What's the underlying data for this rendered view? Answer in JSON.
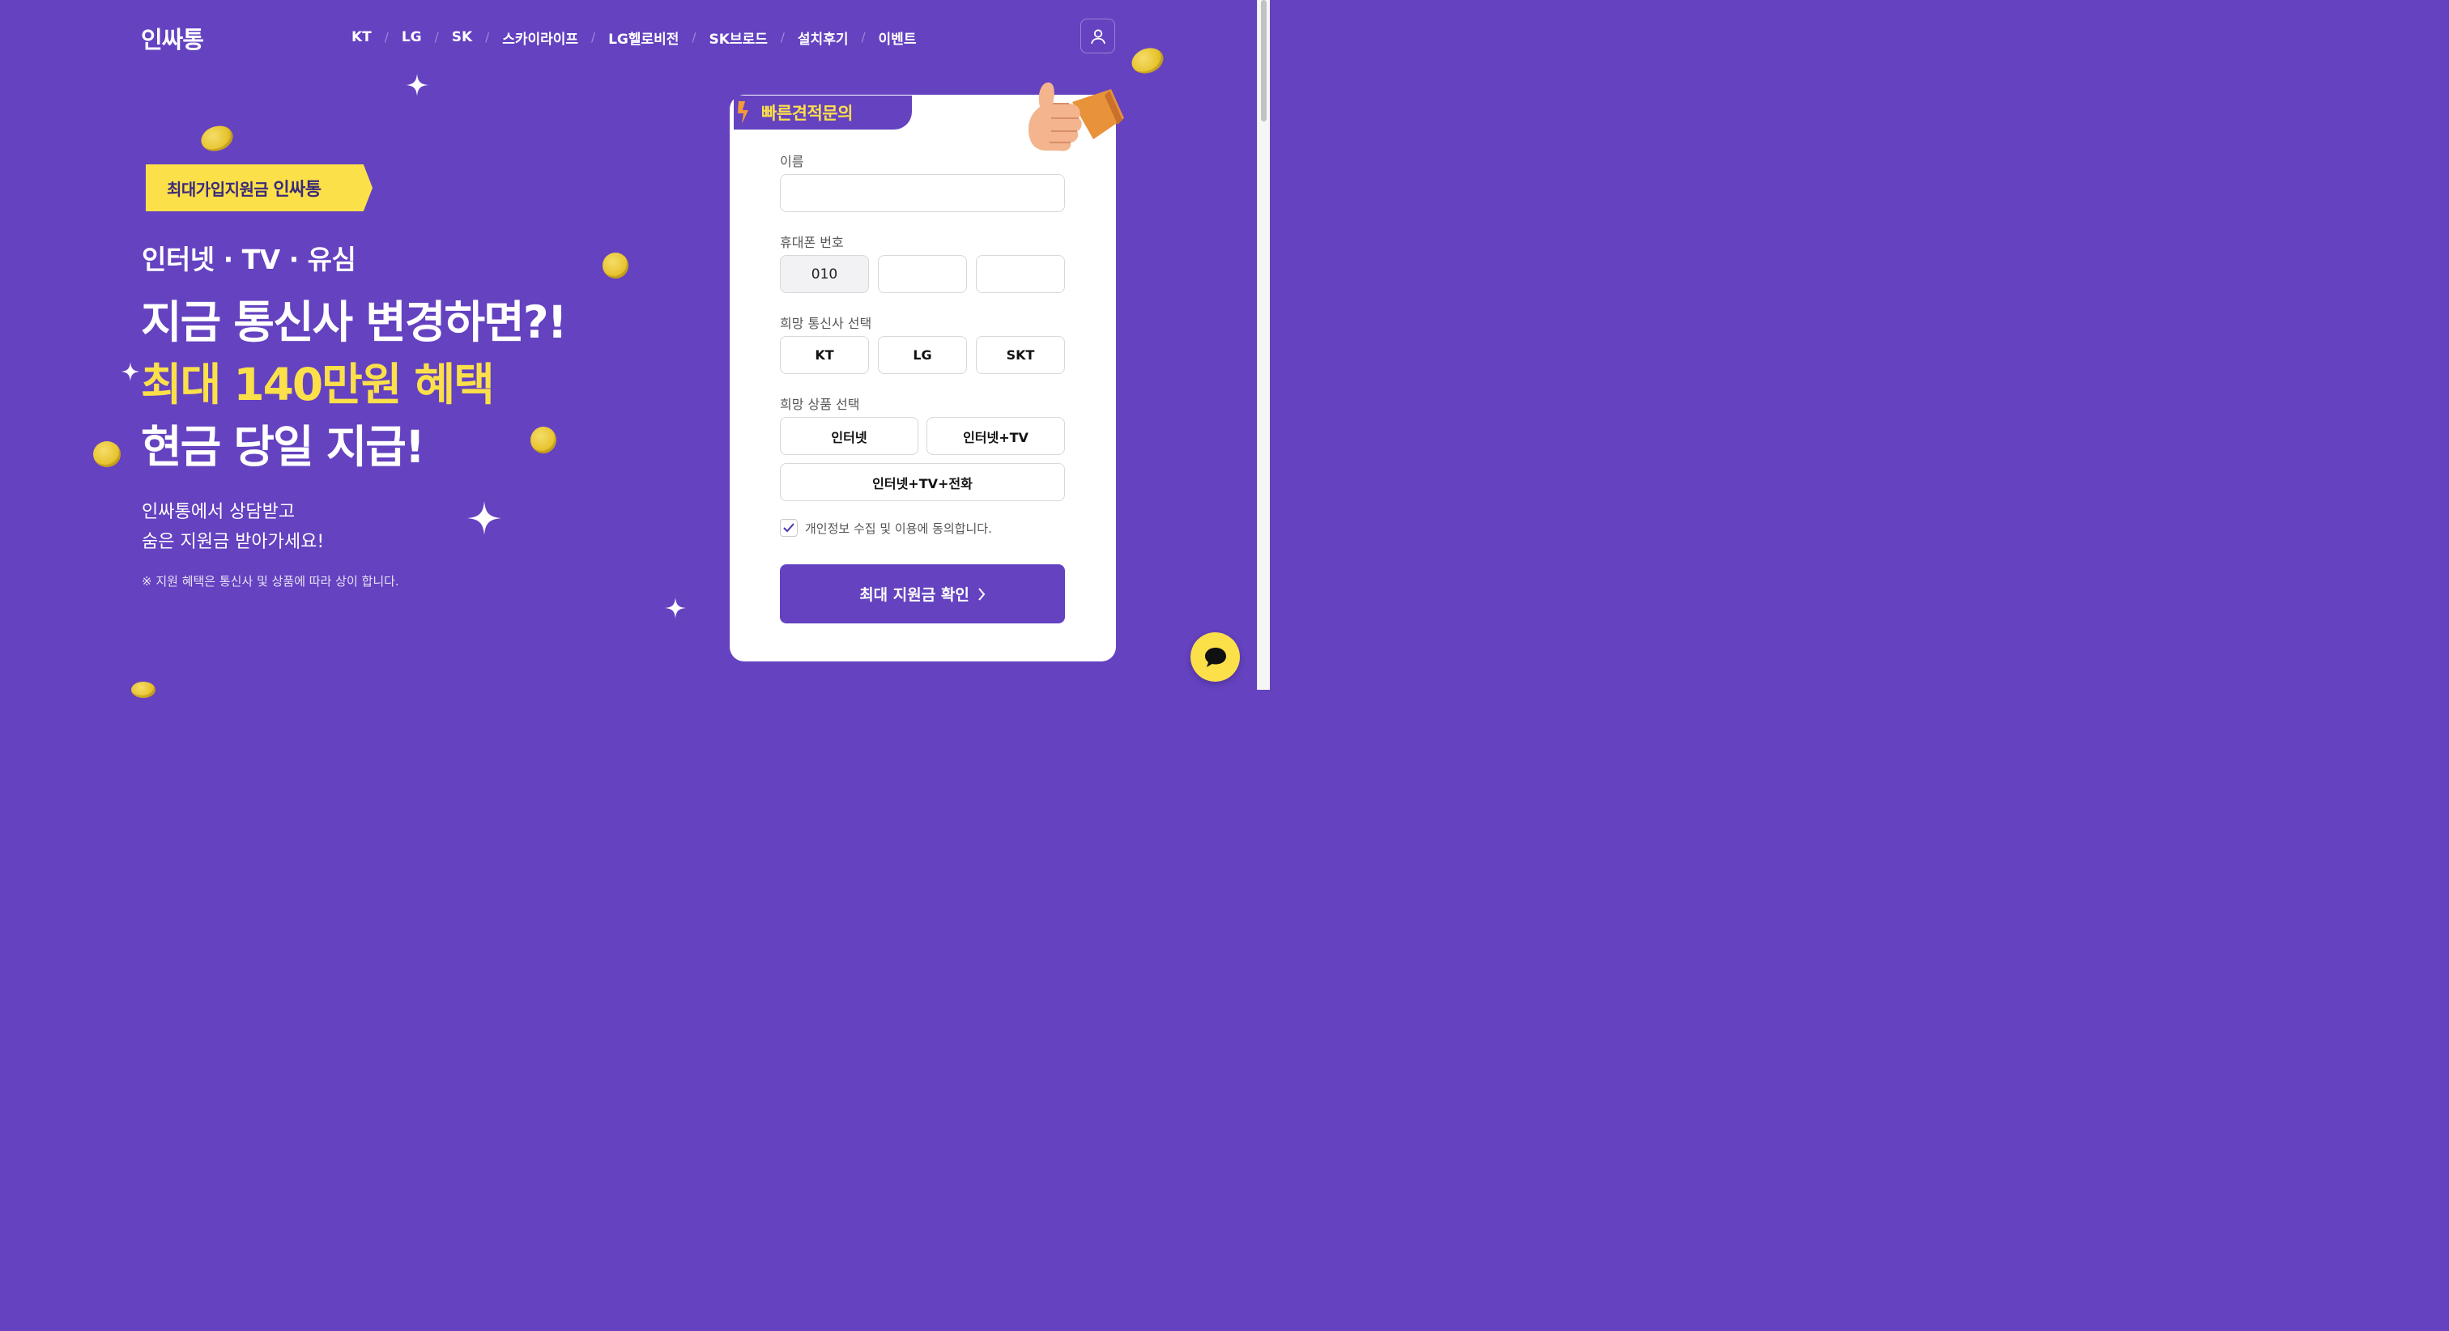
{
  "header": {
    "logo": "인싸통",
    "nav": [
      "KT",
      "LG",
      "SK",
      "스카이라이프",
      "LG헬로비전",
      "SK브로드",
      "설치후기",
      "이벤트"
    ],
    "user_icon": "user-icon"
  },
  "hero": {
    "badge_text": "최대가입지원금",
    "badge_brand": "인싸통",
    "sub": "인터넷 · TV · 유심",
    "line1": "지금 통신사 변경하면?!",
    "line2": "최대 140만원 혜택",
    "line3": "현금 당일 지급!",
    "desc1": "인싸통에서 상담받고",
    "desc2": "숨은 지원금 받아가세요!",
    "note": "※ 지원 혜택은 통신사 및 상품에 따라 상이 합니다."
  },
  "form": {
    "tab_title": "빠른견적문의",
    "name_label": "이름",
    "name_value": "",
    "phone_label": "휴대폰 번호",
    "phone_prefix": "010",
    "phone_mid": "",
    "phone_last": "",
    "carrier_label": "희망 통신사 선택",
    "carriers": [
      "KT",
      "LG",
      "SKT"
    ],
    "product_label": "희망 상품 선택",
    "products": [
      "인터넷",
      "인터넷+TV",
      "인터넷+TV+전화"
    ],
    "agree_text": "개인정보 수집 및 이용에 동의합니다.",
    "agree_checked": true,
    "submit_label": "최대 지원금 확인"
  },
  "colors": {
    "background": "#6442c0",
    "accent_yellow": "#fbe04a",
    "button": "#6442c0"
  },
  "chat_icon": "chat-bubble-icon"
}
